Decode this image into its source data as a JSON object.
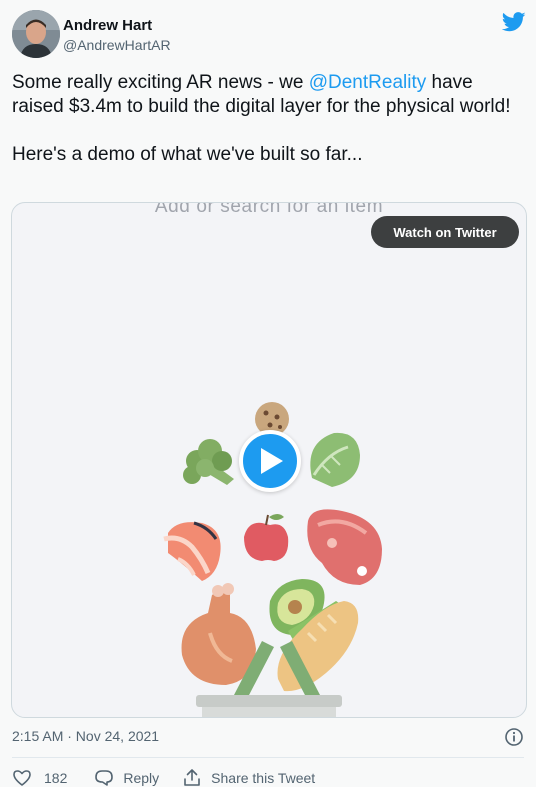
{
  "author": {
    "name": "Andrew Hart",
    "handle": "@AndrewHartAR"
  },
  "tweet": {
    "text_before_mention": "Some really exciting AR news - we ",
    "mention": "@DentReality",
    "text_after_mention": " have raised $3.4m to build the digital layer for the physical world!",
    "text_second_paragraph": "Here's a demo of what we've built so far..."
  },
  "media": {
    "video_caption": "Add or search for an item",
    "watch_button_label": "Watch on Twitter"
  },
  "timestamp": "2:15 AM · Nov 24, 2021",
  "actions": {
    "like_count": "182",
    "reply_label": "Reply",
    "share_label": "Share this Tweet"
  },
  "colors": {
    "brand": "#1d9bf0",
    "text": "#0f1419",
    "secondary_text": "#536471",
    "watch_button_bg": "#3d3f40"
  },
  "icons": [
    "twitter-bird-icon",
    "play-icon",
    "info-icon",
    "heart-icon",
    "reply-icon",
    "share-icon"
  ]
}
